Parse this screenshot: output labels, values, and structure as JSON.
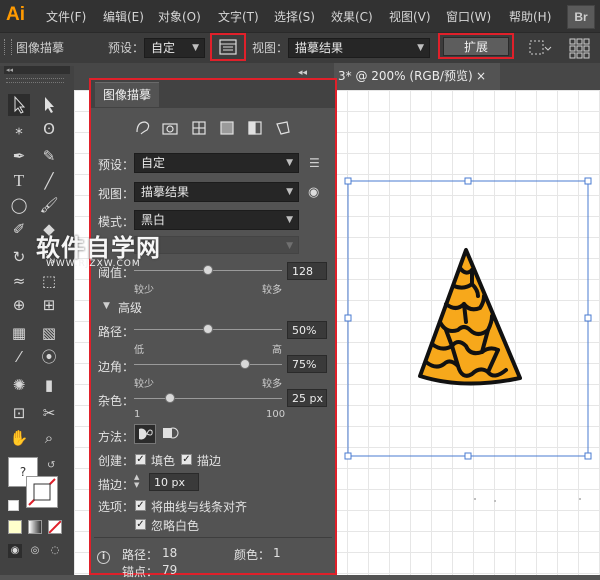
{
  "app": {
    "logo": "Ai",
    "br_badge": "Br"
  },
  "menu": [
    "文件(F)",
    "编辑(E)",
    "对象(O)",
    "文字(T)",
    "选择(S)",
    "效果(C)",
    "视图(V)",
    "窗口(W)",
    "帮助(H)"
  ],
  "control_bar": {
    "panel_name": "图像描摹",
    "preset_label": "预设：",
    "preset_value": "自定",
    "view_label": "视图：",
    "view_value": "描摹结果",
    "expand_label": "扩展"
  },
  "document_tab": {
    "title": "3* @ 200% (RGB/预览)",
    "close": "×"
  },
  "panel": {
    "title": "图像描摹",
    "preset_label": "预设：",
    "preset_value": "自定",
    "view_label": "视图：",
    "view_value": "描摹结果",
    "mode_label": "模式：",
    "mode_value": "黑白",
    "threshold": {
      "label": "阈值：",
      "value": "128",
      "min_label": "较少",
      "max_label": "较多",
      "level": 0.5
    },
    "advanced_label": "高级",
    "paths": {
      "label": "路径：",
      "value": "50%",
      "min_label": "低",
      "max_label": "高",
      "level": 0.5
    },
    "corners": {
      "label": "边角：",
      "value": "75%",
      "min_label": "较少",
      "max_label": "较多",
      "level": 0.75
    },
    "noise": {
      "label": "杂色：",
      "value": "25 px",
      "min_label": "1",
      "max_label": "100",
      "level": 0.24
    },
    "method_label": "方法：",
    "create_label": "创建：",
    "fill_label": "填色",
    "stroke_label": "描边",
    "stroke_width_label": "描边：",
    "stroke_width_value": "10 px",
    "options_label": "选项：",
    "snap_label": "将曲线与线条对齐",
    "ignore_white_label": "忽略白色",
    "stats": {
      "paths_label": "路径：",
      "paths_value": "18",
      "colors_label": "颜色：",
      "colors_value": "1",
      "anchors_label": "锚点：",
      "anchors_value": "79"
    }
  },
  "watermark": {
    "text": "软件自学网",
    "url": "WWW.RJZXW.COM"
  },
  "colors": {
    "accent_red": "#e0202a",
    "shape_fill": "#f7a81b",
    "shape_stroke": "#111111",
    "selection": "#4a7bd0"
  }
}
